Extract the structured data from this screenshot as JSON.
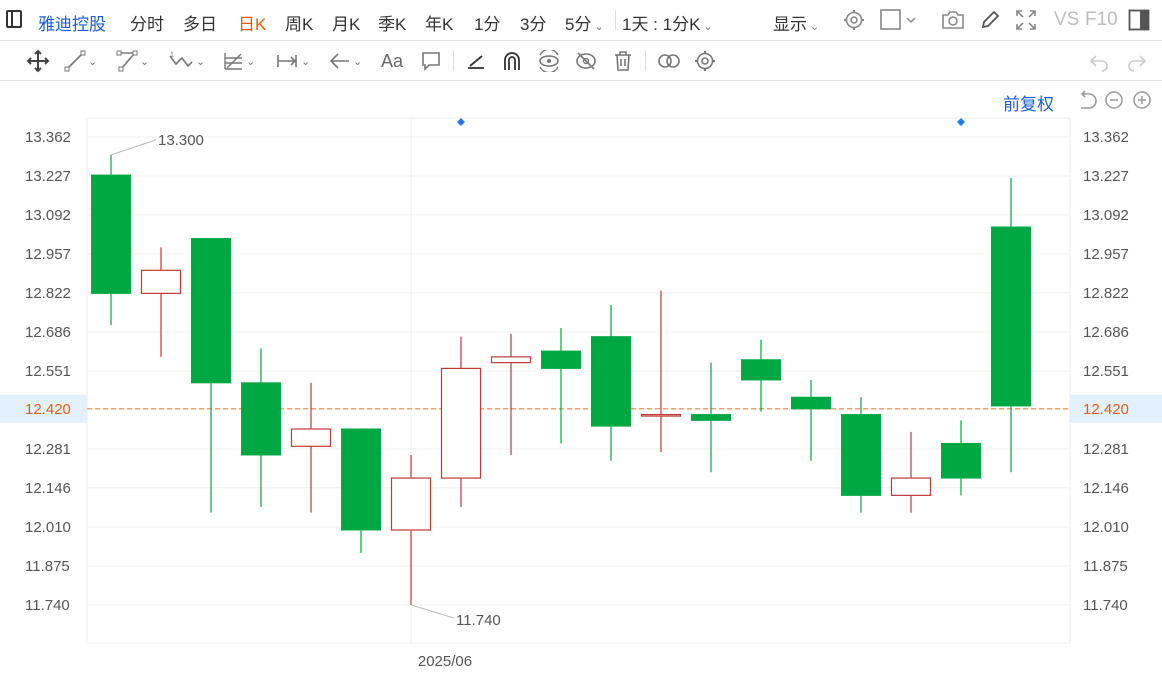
{
  "header": {
    "stock_name": "雅迪控股",
    "periods": [
      "分时",
      "多日",
      "日K",
      "周K",
      "月K",
      "季K",
      "年K",
      "1分",
      "3分",
      "5分"
    ],
    "active_period": "日K",
    "interval_setting": "1天 : 1分K",
    "display_label": "显示",
    "vs_label": "VS",
    "f10_label": "F10"
  },
  "toolbar": {
    "text_tool_label": "Aa",
    "icons": [
      "move-icon",
      "line-icon",
      "polyline-icon",
      "wave-icon",
      "fib-icon",
      "range-icon",
      "arrow-icon",
      "text-icon",
      "comment-icon",
      "brush-icon",
      "magnet-icon",
      "eye-sync-icon",
      "hide-icon",
      "trash-icon",
      "link-icon",
      "settings-icon",
      "undo-icon",
      "redo-icon"
    ]
  },
  "chart_controls": {
    "adjust_label": "前复权"
  },
  "colors": {
    "up": "#c03a36",
    "down": "#00a843",
    "current_line": "#e8834a",
    "current_label_bg": "#e3f0ff",
    "accent": "#1a5fd6",
    "active_period": "#e25d12"
  },
  "chart_data": {
    "type": "candlestick",
    "title": "",
    "x_label": "",
    "y_label": "",
    "y_ticks": [
      "13.362",
      "13.227",
      "13.092",
      "12.957",
      "12.822",
      "12.686",
      "12.551",
      "12.420",
      "12.281",
      "12.146",
      "12.010",
      "11.875",
      "11.740"
    ],
    "ylim": [
      11.74,
      13.362
    ],
    "current_price": "12.420",
    "date_label": "2025/06",
    "high_label": "13.300",
    "low_label": "11.740",
    "grid": true,
    "candles": [
      {
        "open": 13.23,
        "high": 13.3,
        "low": 12.71,
        "close": 12.82
      },
      {
        "open": 12.82,
        "high": 12.98,
        "low": 12.6,
        "close": 12.9
      },
      {
        "open": 13.01,
        "high": 13.01,
        "low": 12.06,
        "close": 12.51
      },
      {
        "open": 12.51,
        "high": 12.63,
        "low": 12.08,
        "close": 12.26
      },
      {
        "open": 12.29,
        "high": 12.51,
        "low": 12.06,
        "close": 12.35
      },
      {
        "open": 12.35,
        "high": 12.35,
        "low": 11.92,
        "close": 12.0
      },
      {
        "open": 12.0,
        "high": 12.26,
        "low": 11.74,
        "close": 12.18
      },
      {
        "open": 12.18,
        "high": 12.67,
        "low": 12.08,
        "close": 12.56
      },
      {
        "open": 12.58,
        "high": 12.68,
        "low": 12.26,
        "close": 12.6
      },
      {
        "open": 12.62,
        "high": 12.7,
        "low": 12.3,
        "close": 12.56
      },
      {
        "open": 12.67,
        "high": 12.78,
        "low": 12.24,
        "close": 12.36
      },
      {
        "open": 12.4,
        "high": 12.83,
        "low": 12.27,
        "close": 12.4
      },
      {
        "open": 12.4,
        "high": 12.58,
        "low": 12.2,
        "close": 12.38
      },
      {
        "open": 12.59,
        "high": 12.66,
        "low": 12.41,
        "close": 12.52
      },
      {
        "open": 12.46,
        "high": 12.52,
        "low": 12.24,
        "close": 12.42
      },
      {
        "open": 12.4,
        "high": 12.46,
        "low": 12.06,
        "close": 12.12
      },
      {
        "open": 12.12,
        "high": 12.34,
        "low": 12.06,
        "close": 12.18
      },
      {
        "open": 12.3,
        "high": 12.38,
        "low": 12.12,
        "close": 12.18
      },
      {
        "open": 13.05,
        "high": 13.22,
        "low": 12.2,
        "close": 12.43
      }
    ]
  }
}
